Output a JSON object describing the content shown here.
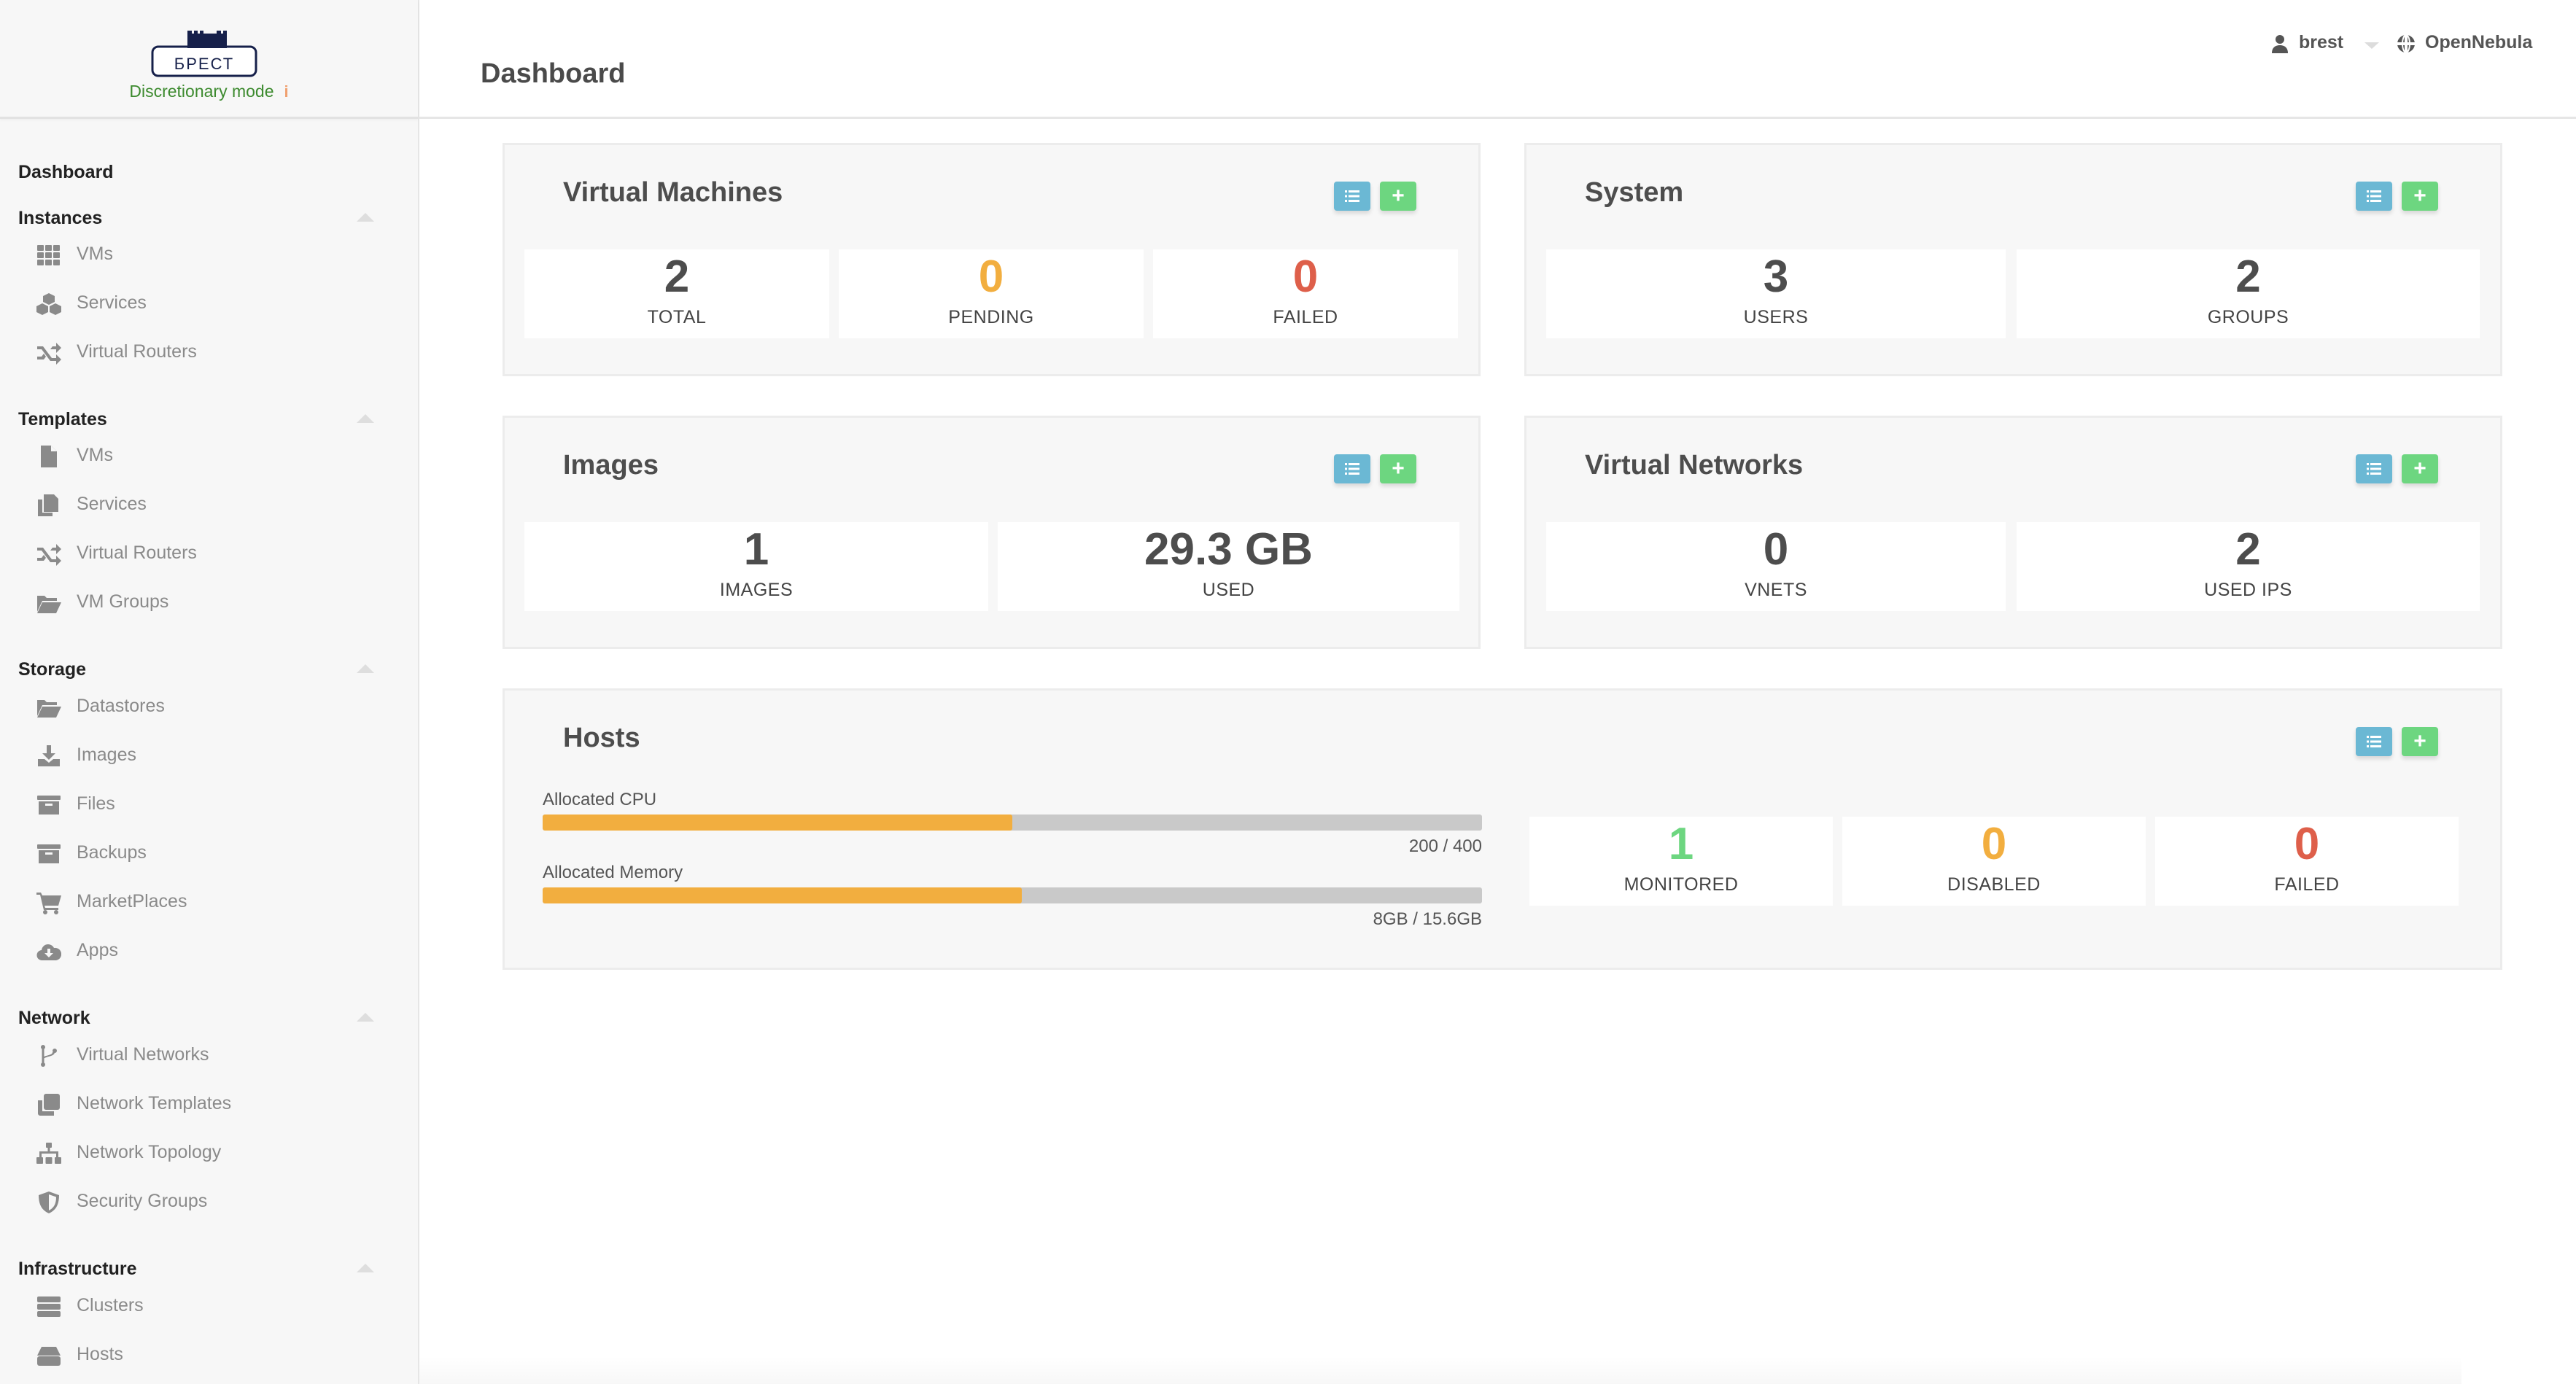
{
  "brand": {
    "logo_text": "БРЕСТ",
    "mode_label": "Discretionary mode",
    "mode_info_icon": "info-icon"
  },
  "header": {
    "title": "Dashboard",
    "user": {
      "name": "brest",
      "icon": "user-icon"
    },
    "zone": {
      "name": "OpenNebula",
      "icon": "globe-icon"
    }
  },
  "sidebar": {
    "top_item": "Dashboard",
    "sections": [
      {
        "label": "Instances",
        "items": [
          {
            "label": "VMs",
            "icon": "grid-icon"
          },
          {
            "label": "Services",
            "icon": "cubes-icon"
          },
          {
            "label": "Virtual Routers",
            "icon": "shuffle-icon"
          }
        ]
      },
      {
        "label": "Templates",
        "items": [
          {
            "label": "VMs",
            "icon": "file-icon"
          },
          {
            "label": "Services",
            "icon": "copy-icon"
          },
          {
            "label": "Virtual Routers",
            "icon": "shuffle-icon"
          },
          {
            "label": "VM Groups",
            "icon": "folder-open-icon"
          }
        ]
      },
      {
        "label": "Storage",
        "items": [
          {
            "label": "Datastores",
            "icon": "folder-open-icon"
          },
          {
            "label": "Images",
            "icon": "download-icon"
          },
          {
            "label": "Files",
            "icon": "archive-icon"
          },
          {
            "label": "Backups",
            "icon": "archive-icon"
          },
          {
            "label": "MarketPlaces",
            "icon": "cart-icon"
          },
          {
            "label": "Apps",
            "icon": "cloud-download-icon"
          }
        ]
      },
      {
        "label": "Network",
        "items": [
          {
            "label": "Virtual Networks",
            "icon": "code-branch-icon"
          },
          {
            "label": "Network Templates",
            "icon": "clone-icon"
          },
          {
            "label": "Network Topology",
            "icon": "sitemap-icon"
          },
          {
            "label": "Security Groups",
            "icon": "shield-icon"
          }
        ]
      },
      {
        "label": "Infrastructure",
        "items": [
          {
            "label": "Clusters",
            "icon": "server-icon"
          },
          {
            "label": "Hosts",
            "icon": "hdd-icon"
          }
        ]
      }
    ]
  },
  "cards": {
    "vms": {
      "title": "Virtual Machines",
      "stats": [
        {
          "value": "2",
          "label": "TOTAL"
        },
        {
          "value": "0",
          "label": "PENDING"
        },
        {
          "value": "0",
          "label": "FAILED"
        }
      ]
    },
    "system": {
      "title": "System",
      "stats": [
        {
          "value": "3",
          "label": "USERS"
        },
        {
          "value": "2",
          "label": "GROUPS"
        }
      ]
    },
    "images": {
      "title": "Images",
      "stats": [
        {
          "value": "1",
          "label": "IMAGES"
        },
        {
          "value": "29.3 GB",
          "label": "USED"
        }
      ]
    },
    "vnets": {
      "title": "Virtual Networks",
      "stats": [
        {
          "value": "0",
          "label": "VNETS"
        },
        {
          "value": "2",
          "label": "USED IPS"
        }
      ]
    },
    "hosts": {
      "title": "Hosts",
      "cpu": {
        "label": "Allocated CPU",
        "value_text": "200 / 400",
        "percent": 50
      },
      "memory": {
        "label": "Allocated Memory",
        "value_text": "8GB / 15.6GB",
        "percent": 51
      },
      "stats": [
        {
          "value": "1",
          "label": "MONITORED"
        },
        {
          "value": "0",
          "label": "DISABLED"
        },
        {
          "value": "0",
          "label": "FAILED"
        }
      ]
    }
  },
  "colors": {
    "list_button": "#6bb8d4",
    "add_button": "#6dd680",
    "warning": "#f2ae3f",
    "danger": "#de5f4a",
    "success": "#6dd680",
    "mode_text": "#3c8a2e"
  }
}
